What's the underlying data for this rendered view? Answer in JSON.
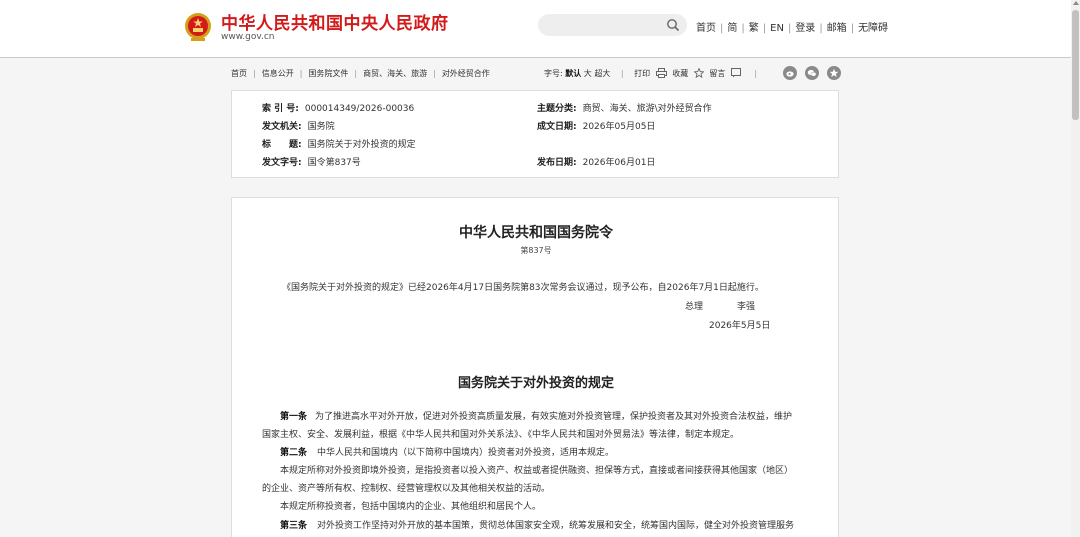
{
  "site": {
    "title": "中华人民共和国中央人民政府",
    "url": "www.gov.cn",
    "top_links": [
      "首页",
      "简",
      "繁",
      "EN",
      "登录",
      "邮箱",
      "无障碍"
    ]
  },
  "breadcrumb": [
    "首页",
    "信息公开",
    "国务院文件",
    "商贸、海关、旅游",
    "对外经贸合作"
  ],
  "tools": {
    "font_label": "字号:",
    "font_default": "默认",
    "font_large": "大",
    "font_xlarge": "超大",
    "print": "打印",
    "favorite": "收藏",
    "comment": "留言"
  },
  "info": {
    "index_label": "索 引 号:",
    "index_value": "000014349/2026-00036",
    "category_label": "主题分类:",
    "category_value": "商贸、海关、旅游\\对外经贸合作",
    "issuer_label": "发文机关:",
    "issuer_value": "国务院",
    "created_label": "成文日期:",
    "created_value": "2026年05月05日",
    "title_label": "标　　题:",
    "title_value": "国务院关于对外投资的规定",
    "docnum_label": "发文字号:",
    "docnum_value": "国令第837号",
    "published_label": "发布日期:",
    "published_value": "2026年06月01日"
  },
  "article": {
    "decree_title": "中华人民共和国国务院令",
    "decree_number": "第837号",
    "intro": "《国务院关于对外投资的规定》已经2026年4月17日国务院第83次常务会议通过，现予公布，自2026年7月1日起施行。",
    "signer_title": "总理",
    "signer_name": "李强",
    "sign_date": "2026年5月5日",
    "reg_title": "国务院关于对外投资的规定",
    "art1_label": "第一条",
    "art1_line1": "为了推进高水平对外开放，促进对外投资高质量发展，有效实施对外投资管理，保护投资者及其对外投资合法权益，维护",
    "art1_line2": "国家主权、安全、发展利益，根据《中华人民共和国对外关系法》、《中华人民共和国对外贸易法》等法律，制定本规定。",
    "art2_label": "第二条",
    "art2_line1": "中华人民共和国境内（以下简称中国境内）投资者对外投资，适用本规定。",
    "art2_p2_line1": "本规定所称对外投资即境外投资，是指投资者以投入资产、权益或者提供融资、担保等方式，直接或者间接获得其他国家（地区）",
    "art2_p2_line2": "的企业、资产等所有权、控制权、经营管理权以及其他相关权益的活动。",
    "art2_p3": "本规定所称投资者，包括中国境内的企业、其他组织和居民个人。",
    "art3_label": "第三条",
    "art3_line1": "对外投资工作坚持对外开放的基本国策，贯彻总体国家安全观，统筹发展和安全，统筹国内国际，健全对外投资管理服务"
  }
}
